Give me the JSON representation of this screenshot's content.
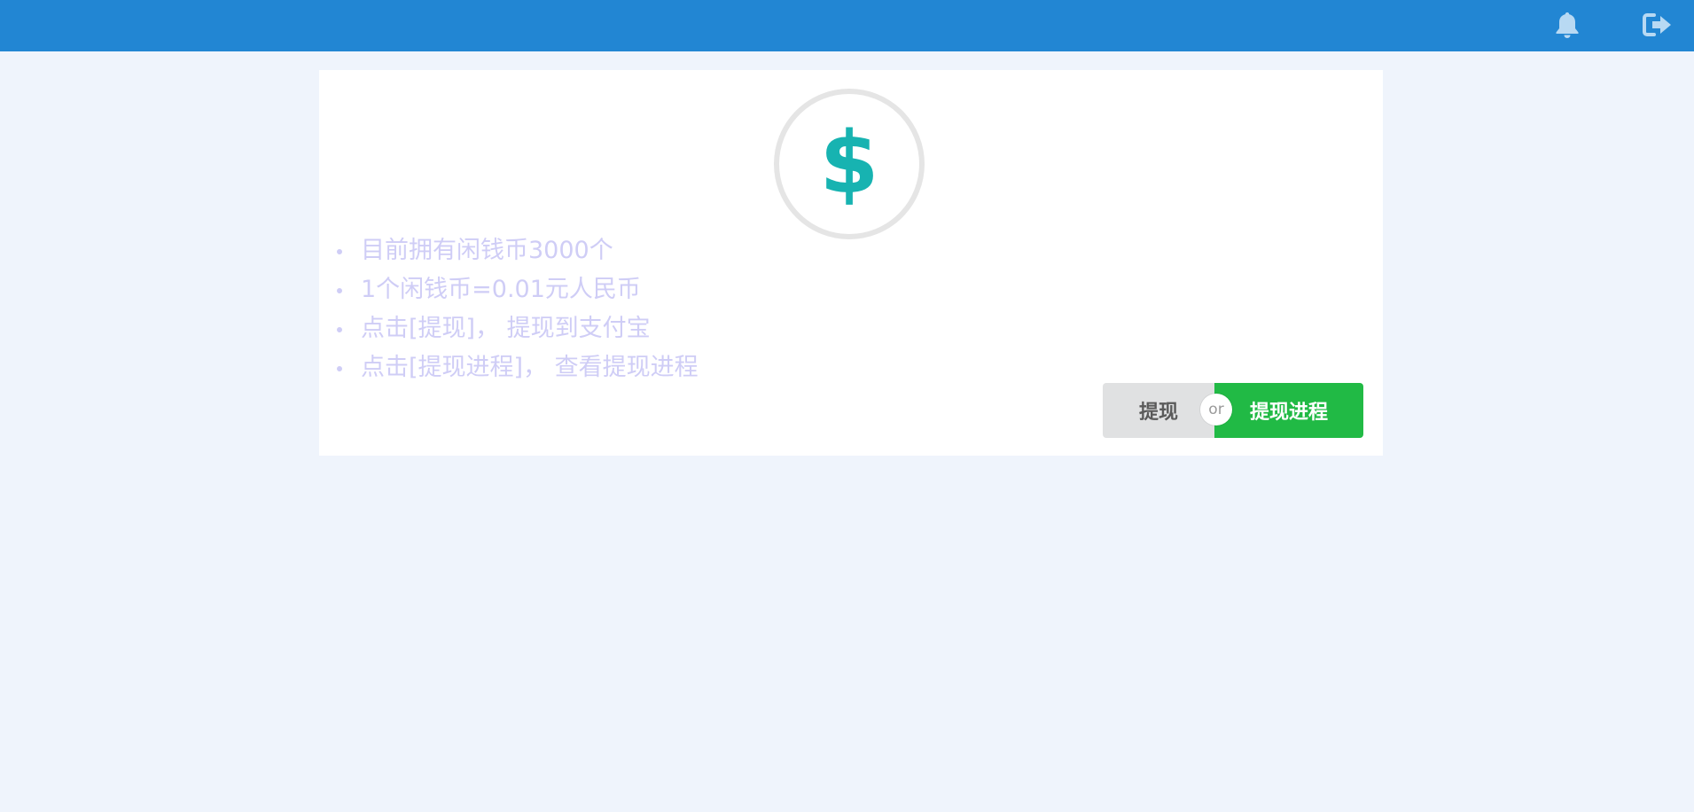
{
  "header": {
    "notification_icon": "bell-icon",
    "logout_icon": "sign-out-icon",
    "background_color": "#2286d3",
    "icon_color": "#b8d9f3"
  },
  "wallet": {
    "coin_symbol": "$",
    "coin_color": "#17b3b1",
    "info_items": [
      "目前拥有闲钱币3000个",
      "1个闲钱币=0.01元人民币",
      "点击[提现]， 提现到支付宝",
      "点击[提现进程]， 查看提现进程"
    ]
  },
  "actions": {
    "withdraw_label": "提现",
    "or_label": "or",
    "progress_label": "提现进程",
    "progress_color": "#21ba45"
  }
}
